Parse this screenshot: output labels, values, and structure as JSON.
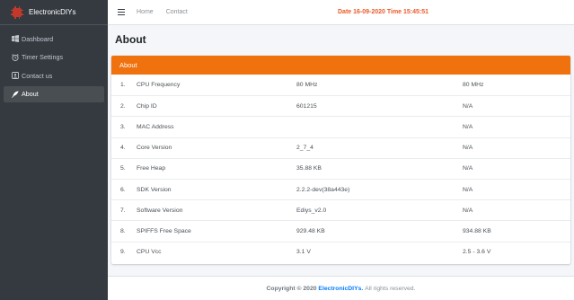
{
  "app": {
    "name": "ElectronicDIYs"
  },
  "sidebar": {
    "items": [
      {
        "label": "Dashboard",
        "icon": "windows-icon"
      },
      {
        "label": "Timer Settings",
        "icon": "clock-icon"
      },
      {
        "label": "Contact us",
        "icon": "user-icon"
      },
      {
        "label": "About",
        "icon": "feather-icon",
        "active": true
      }
    ]
  },
  "topbar": {
    "home": "Home",
    "contact": "Contact",
    "datetime": "Date 16-09-2020 Time 15:45:51"
  },
  "page": {
    "title": "About"
  },
  "card": {
    "header": "About",
    "rows": [
      {
        "index": "1.",
        "name": "CPU Frequency",
        "value": "80 MHz",
        "other": "80 MHz"
      },
      {
        "index": "2.",
        "name": "Chip ID",
        "value": "601215",
        "other": "N/A"
      },
      {
        "index": "3.",
        "name": "MAC Address",
        "value": "",
        "other": "N/A"
      },
      {
        "index": "4.",
        "name": "Core Version",
        "value": "2_7_4",
        "other": "N/A"
      },
      {
        "index": "5.",
        "name": "Free Heap",
        "value": "35.88 KB",
        "other": "N/A"
      },
      {
        "index": "6.",
        "name": "SDK Version",
        "value": "2.2.2-dev(38a443e)",
        "other": "N/A"
      },
      {
        "index": "7.",
        "name": "Software Version",
        "value": "Ediys_v2.0",
        "other": "N/A"
      },
      {
        "index": "8.",
        "name": "SPIFFS Free Space",
        "value": "929.48 KB",
        "other": "934.88 KB"
      },
      {
        "index": "9.",
        "name": "CPU Vcc",
        "value": "3.1 V",
        "other": "2.5 - 3.6 V"
      }
    ]
  },
  "footer": {
    "prefix": "Copyright © 2020",
    "link": "ElectronicDIYs.",
    "suffix": "All rights reserved."
  },
  "colors": {
    "accent": "#f0720f",
    "datetime": "#ea5a28",
    "sidebar": "#343a40",
    "link": "#007bff"
  }
}
